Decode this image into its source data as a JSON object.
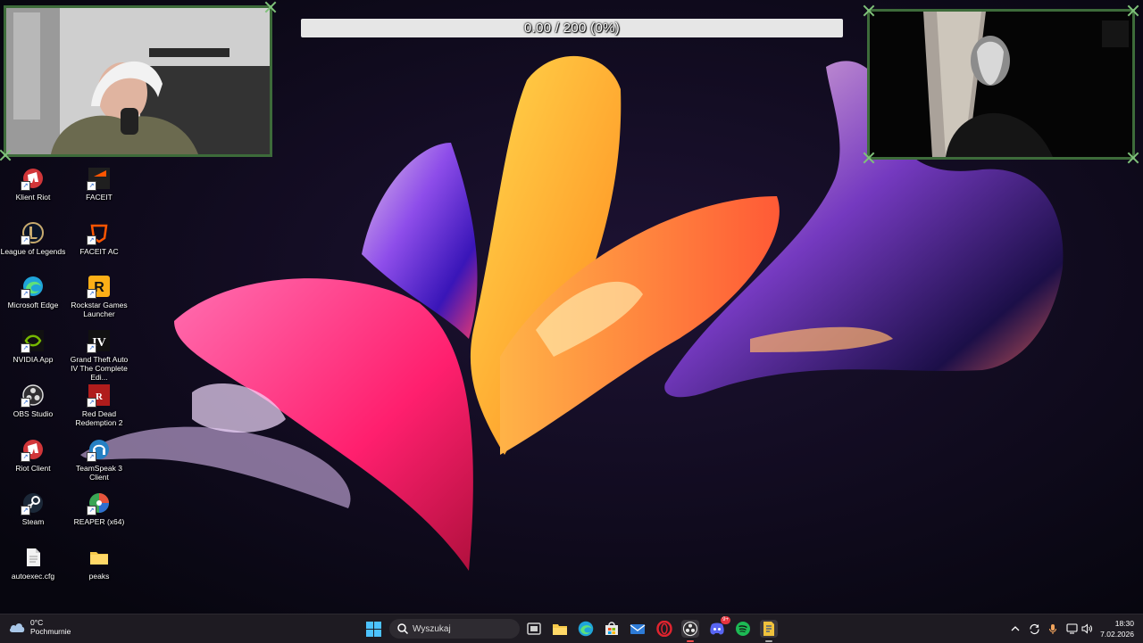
{
  "progress": {
    "text": "0.00 / 200 (0%)",
    "value": 0,
    "max": 200,
    "percent": 0
  },
  "desktop_icons": [
    {
      "label": "Klient Riot",
      "icon": "riot-client-icon",
      "color": "#d13639"
    },
    {
      "label": "FACEIT",
      "icon": "faceit-icon",
      "color": "#ff5500"
    },
    {
      "label": "League of Legends",
      "icon": "league-of-legends-icon",
      "color": "#c8aa6e"
    },
    {
      "label": "FACEIT AC",
      "icon": "faceit-ac-icon",
      "color": "#ff5500"
    },
    {
      "label": "Microsoft Edge",
      "icon": "edge-icon",
      "color": "#1fa4d9"
    },
    {
      "label": "Rockstar Games Launcher",
      "icon": "rockstar-icon",
      "color": "#fcaf17"
    },
    {
      "label": "NVIDIA App",
      "icon": "nvidia-icon",
      "color": "#76b900"
    },
    {
      "label": "Grand Theft Auto IV The Complete Edi...",
      "icon": "gta-iv-icon",
      "color": "#ffffff"
    },
    {
      "label": "OBS Studio",
      "icon": "obs-icon",
      "color": "#302e31"
    },
    {
      "label": "Red Dead Redemption 2",
      "icon": "rdr2-icon",
      "color": "#b01c1c"
    },
    {
      "label": "Riot Client",
      "icon": "riot-client-icon",
      "color": "#d13639"
    },
    {
      "label": "TeamSpeak 3 Client",
      "icon": "teamspeak-icon",
      "color": "#2580c3"
    },
    {
      "label": "Steam",
      "icon": "steam-icon",
      "color": "#1b2838"
    },
    {
      "label": "REAPER (x64)",
      "icon": "reaper-icon",
      "color": "#3aa655"
    },
    {
      "label": "autoexec.cfg",
      "icon": "file-icon",
      "color": "#ffffff"
    },
    {
      "label": "peaks",
      "icon": "folder-icon",
      "color": "#f6c94a"
    }
  ],
  "taskbar": {
    "weather": {
      "temp": "0°C",
      "condition": "Pochmurnie",
      "icon": "cloud-icon"
    },
    "search_placeholder": "Wyszukaj",
    "apps": [
      {
        "name": "task-view-icon",
        "color": "#cfcfcf"
      },
      {
        "name": "file-explorer-icon",
        "color": "#f6c94a"
      },
      {
        "name": "edge-icon",
        "color": "#1fa4d9"
      },
      {
        "name": "microsoft-store-icon",
        "color": "#e8e8e8"
      },
      {
        "name": "mail-icon",
        "color": "#2d7ad6"
      },
      {
        "name": "opera-icon",
        "color": "#e0242f"
      },
      {
        "name": "obs-icon",
        "color": "#e6e6e6"
      },
      {
        "name": "discord-icon",
        "color": "#5865f2"
      },
      {
        "name": "spotify-icon",
        "color": "#1db954"
      },
      {
        "name": "file-icon",
        "color": "#f0c23c"
      }
    ],
    "discord_badge": "9+",
    "tray": [
      "chevron-up-icon",
      "refresh-icon",
      "microphone-icon",
      "display-icon",
      "volume-icon"
    ],
    "time": "18:30",
    "date": "7.02.2026"
  },
  "colors": {
    "accent": "#4cc2ff",
    "frame": "#3d6b3a",
    "taskbar": "#1e1b22"
  }
}
